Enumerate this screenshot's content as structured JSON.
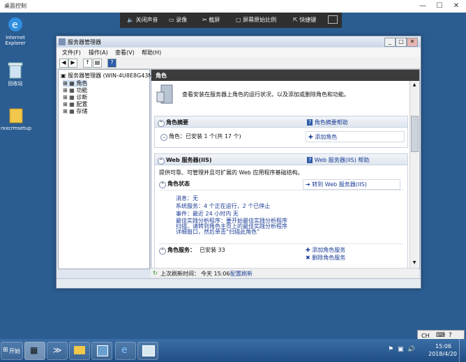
{
  "outer_window": {
    "title": "桌面控制",
    "min": "—",
    "max": "☐",
    "close": "✕"
  },
  "remote_bar": {
    "items": [
      "关闭声音",
      "录像",
      "截屏",
      "屏幕原始比例",
      "快捷键"
    ]
  },
  "desktop_icons": [
    {
      "label": "Internet Explorer"
    },
    {
      "label": "回收站"
    },
    {
      "label": "rxxcrmsetup"
    }
  ],
  "window": {
    "title": "服务器管理器",
    "menu": [
      "文件(F)",
      "操作(A)",
      "查看(V)",
      "帮助(H)"
    ],
    "tree": {
      "root": "服务器管理器 (WIN-4U8E8G43MV",
      "items": [
        "角色",
        "功能",
        "诊断",
        "配置",
        "存储"
      ]
    },
    "pane_title": "角色",
    "intro": "查看安装在服务器上角色的运行状况，以及添加或删除角色和功能。",
    "summary": {
      "header": "角色摘要",
      "help": "角色摘要帮助",
      "roles_label": "角色：",
      "roles_value": "已安装 1 个(共 17 个)",
      "add_role": "添加角色"
    },
    "iis": {
      "header": "Web 服务器(IIS)",
      "help": "Web 服务器(IIS) 帮助",
      "desc": "提供可靠、可管理并且可扩展的 Web 应用程序基础结构。",
      "status_header": "角色状态",
      "goto": "转到 Web 服务器(IIS)",
      "messages": "消息：无",
      "system_services": "系统服务：4 个正在运行，2 个已停止",
      "events": "事件：最近 24 小时内 无",
      "bpa1": "最佳实践分析程序：要开始最佳实践分析程序",
      "bpa2": "扫描，请转到角色主页上的最佳实践分析程序",
      "bpa3": "详细窗口，然后单击“扫描此角色”",
      "role_services_label": "角色服务：",
      "role_services_value": "已安装 33",
      "add_services": "添加角色服务",
      "remove_services": "删除角色服务"
    },
    "status": {
      "label": "上次刷新时间：",
      "time": "今天 15:06",
      "refresh": "配置刷新"
    }
  },
  "taskbar": {
    "start": "开始",
    "clock_time": "15:06",
    "clock_date": "2018/4/20",
    "ime": "CH"
  }
}
